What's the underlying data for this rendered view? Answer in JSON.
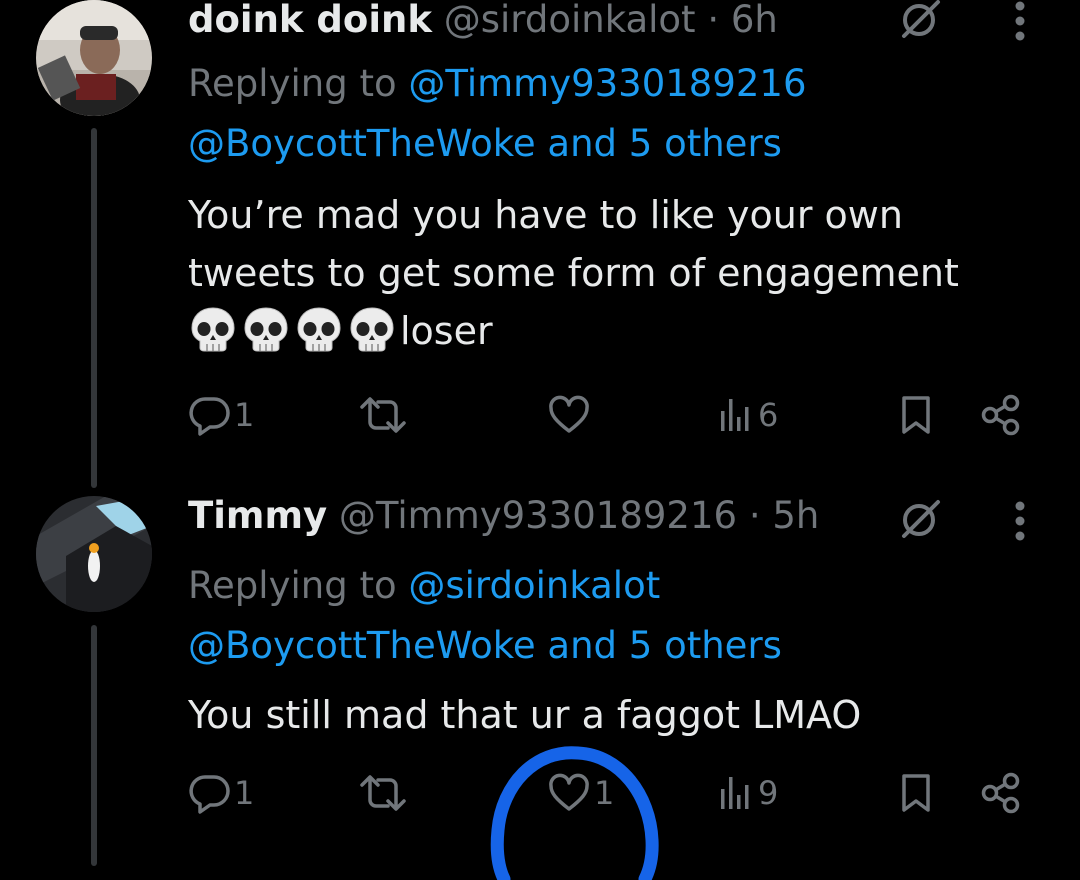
{
  "tweets": [
    {
      "display_name": "doink doink",
      "handle": "@sirdoinkalot",
      "separator": "·",
      "time": "6h",
      "replying_prefix": "Replying to",
      "replying_to": "@Timmy9330189216",
      "replying_rest": "@BoycottTheWoke and 5 others",
      "text_line1": "You’re mad you have to like your own",
      "text_line2": "tweets to get some form of engagement",
      "text_tail": "loser",
      "skull_emoji_count": 4,
      "reply_count": "1",
      "retweet_count": "",
      "like_count": "",
      "view_count": "6"
    },
    {
      "display_name": "Timmy",
      "handle": "@Timmy9330189216",
      "separator": "·",
      "time": "5h",
      "replying_prefix": "Replying to",
      "replying_to": "@sirdoinkalot",
      "replying_rest": "@BoycottTheWoke and 5 others",
      "text_line1": "You still mad that ur a faggot LMAO",
      "reply_count": "1",
      "retweet_count": "",
      "like_count": "1",
      "view_count": "9"
    }
  ],
  "icons": {
    "reply": "speech-bubble-icon",
    "retweet": "retweet-arrows-icon",
    "like": "heart-icon",
    "views": "bar-chart-icon",
    "bookmark": "bookmark-icon",
    "share": "share-nodes-icon",
    "grok": "grok-slash-circle-icon",
    "more": "three-dots-vertical-icon"
  },
  "colors": {
    "background": "#000000",
    "text": "#e7e9ea",
    "muted": "#71767b",
    "link": "#1d9bf0",
    "annotation": "#1664e8"
  }
}
